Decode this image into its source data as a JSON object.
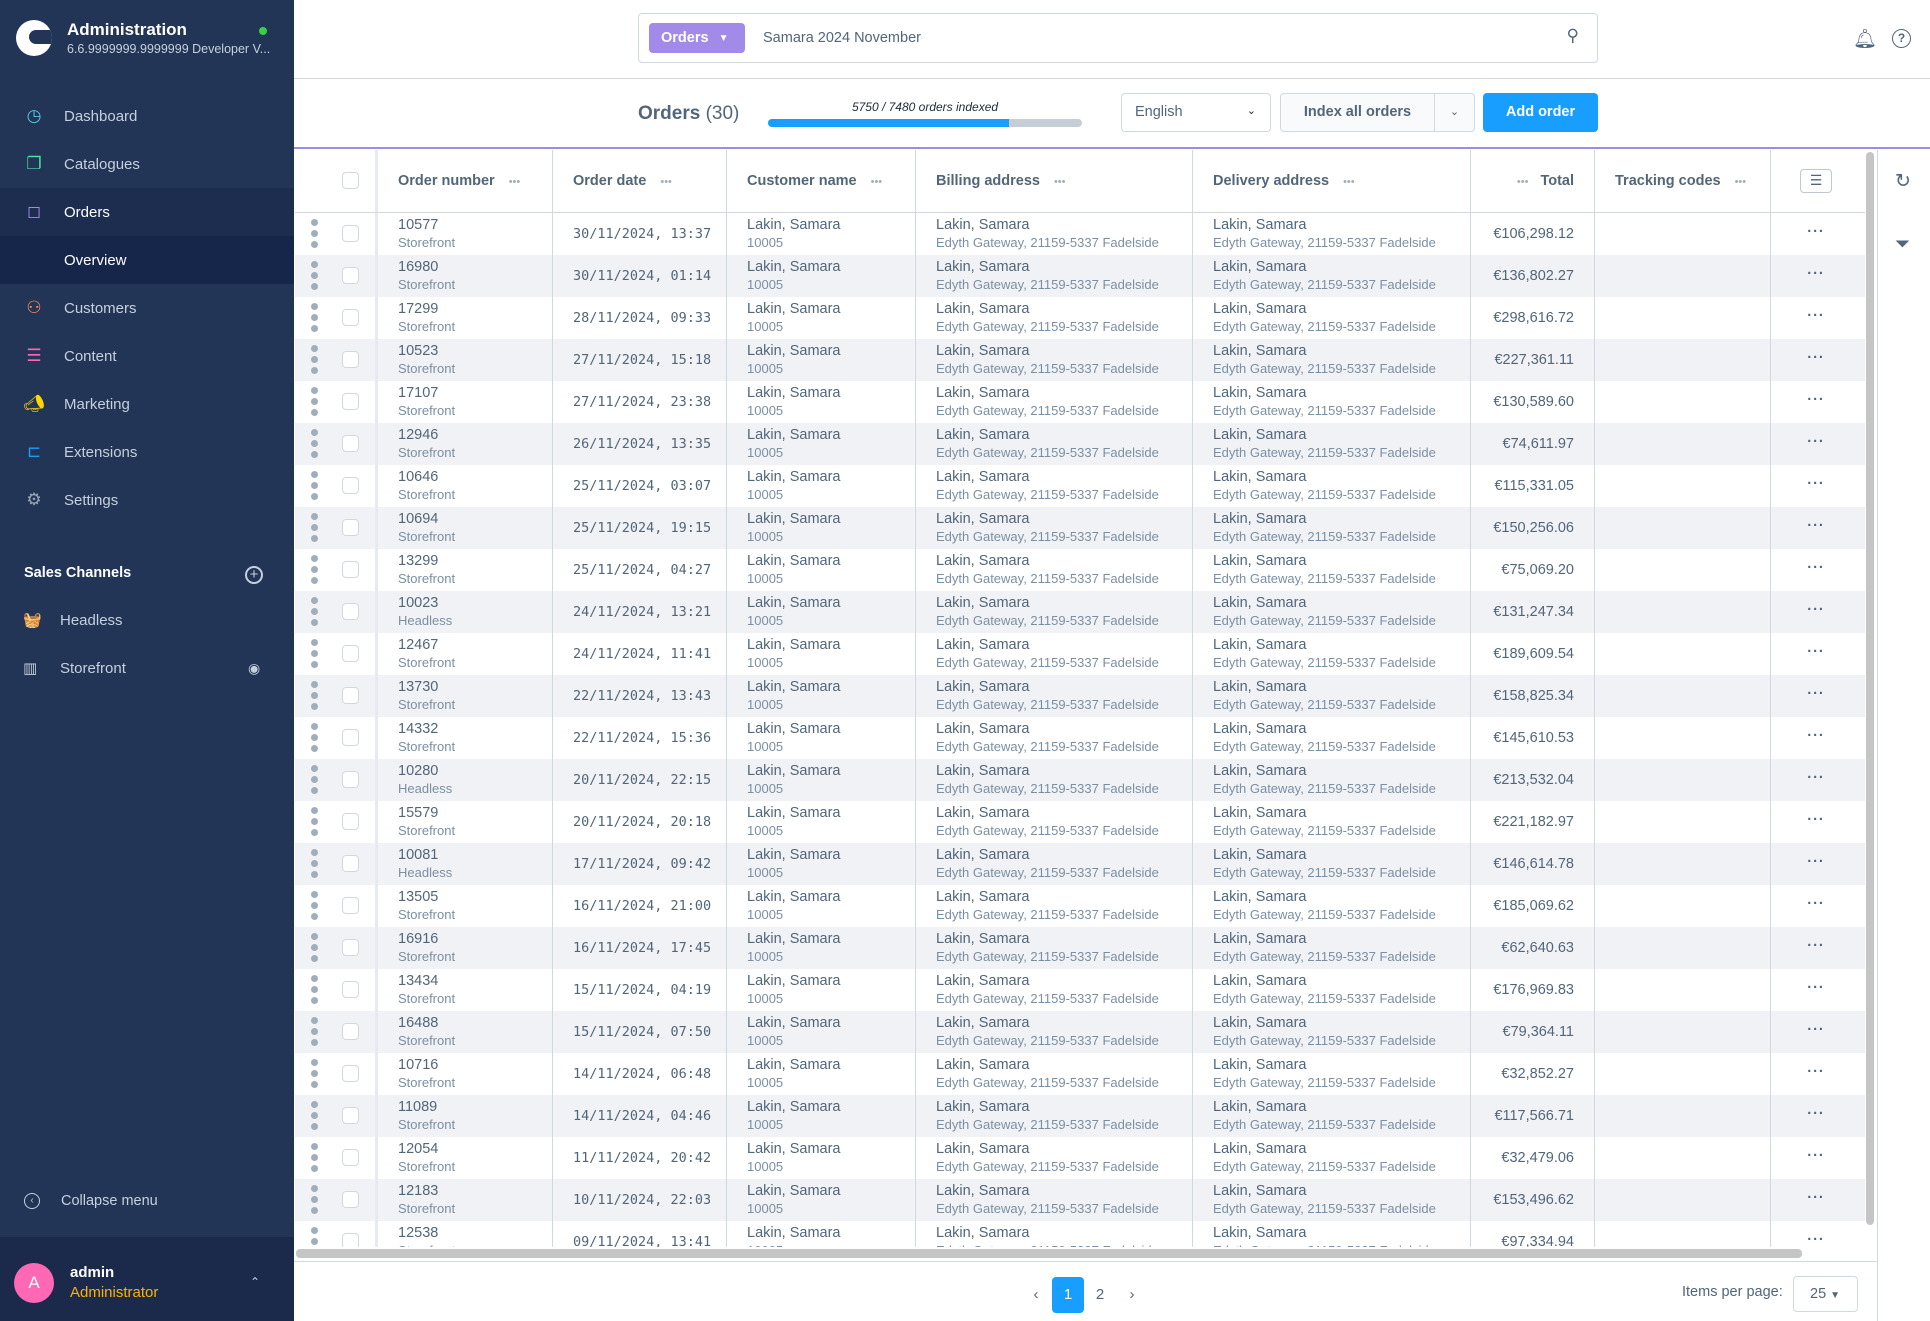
{
  "app": {
    "title": "Administration",
    "version": "6.6.9999999.9999999 Developer V...",
    "status_color": "#37d046"
  },
  "sidebar": {
    "items": [
      {
        "label": "Dashboard",
        "icon": "dashboard-icon",
        "color": "#5bc6e8"
      },
      {
        "label": "Catalogues",
        "icon": "catalogue-icon",
        "color": "#57d9a3"
      },
      {
        "label": "Orders",
        "icon": "orders-icon",
        "color": "#a28ae8",
        "active": true
      },
      {
        "label": "Overview",
        "sub": true
      },
      {
        "label": "Customers",
        "icon": "customers-icon",
        "color": "#ff8f57"
      },
      {
        "label": "Content",
        "icon": "content-icon",
        "color": "#ff68b4"
      },
      {
        "label": "Marketing",
        "icon": "marketing-icon",
        "color": "#ffd700"
      },
      {
        "label": "Extensions",
        "icon": "extensions-icon",
        "color": "#189eff"
      },
      {
        "label": "Settings",
        "icon": "settings-icon",
        "color": "#9aa8b5"
      }
    ],
    "sales_channels_title": "Sales Channels",
    "channels": [
      {
        "label": "Headless"
      },
      {
        "label": "Storefront"
      }
    ],
    "collapse_label": "Collapse menu",
    "user": {
      "initial": "A",
      "name": "admin",
      "role": "Administrator"
    }
  },
  "search": {
    "type": "Orders",
    "value": "Samara 2024 November"
  },
  "page": {
    "title": "Orders",
    "count": "(30)",
    "index_label": "5750 / 7480 orders indexed",
    "index_progress": 0.7687,
    "language": "English",
    "index_button": "Index all orders",
    "add_button": "Add order"
  },
  "table": {
    "columns": [
      "Order number",
      "Order date",
      "Customer name",
      "Billing address",
      "Delivery address",
      "Total",
      "Tracking codes"
    ],
    "rows": [
      [
        "10577",
        "Storefront",
        "30/11/2024, 13:37",
        "€106,298.12"
      ],
      [
        "16980",
        "Storefront",
        "30/11/2024, 01:14",
        "€136,802.27"
      ],
      [
        "17299",
        "Storefront",
        "28/11/2024, 09:33",
        "€298,616.72"
      ],
      [
        "10523",
        "Storefront",
        "27/11/2024, 15:18",
        "€227,361.11"
      ],
      [
        "17107",
        "Storefront",
        "27/11/2024, 23:38",
        "€130,589.60"
      ],
      [
        "12946",
        "Storefront",
        "26/11/2024, 13:35",
        "€74,611.97"
      ],
      [
        "10646",
        "Storefront",
        "25/11/2024, 03:07",
        "€115,331.05"
      ],
      [
        "10694",
        "Storefront",
        "25/11/2024, 19:15",
        "€150,256.06"
      ],
      [
        "13299",
        "Storefront",
        "25/11/2024, 04:27",
        "€75,069.20"
      ],
      [
        "10023",
        "Headless",
        "24/11/2024, 13:21",
        "€131,247.34"
      ],
      [
        "12467",
        "Storefront",
        "24/11/2024, 11:41",
        "€189,609.54"
      ],
      [
        "13730",
        "Storefront",
        "22/11/2024, 13:43",
        "€158,825.34"
      ],
      [
        "14332",
        "Storefront",
        "22/11/2024, 15:36",
        "€145,610.53"
      ],
      [
        "10280",
        "Headless",
        "20/11/2024, 22:15",
        "€213,532.04"
      ],
      [
        "15579",
        "Storefront",
        "20/11/2024, 20:18",
        "€221,182.97"
      ],
      [
        "10081",
        "Headless",
        "17/11/2024, 09:42",
        "€146,614.78"
      ],
      [
        "13505",
        "Storefront",
        "16/11/2024, 21:00",
        "€185,069.62"
      ],
      [
        "16916",
        "Storefront",
        "16/11/2024, 17:45",
        "€62,640.63"
      ],
      [
        "13434",
        "Storefront",
        "15/11/2024, 04:19",
        "€176,969.83"
      ],
      [
        "16488",
        "Storefront",
        "15/11/2024, 07:50",
        "€79,364.11"
      ],
      [
        "10716",
        "Storefront",
        "14/11/2024, 06:48",
        "€32,852.27"
      ],
      [
        "11089",
        "Storefront",
        "14/11/2024, 04:46",
        "€117,566.71"
      ],
      [
        "12054",
        "Storefront",
        "11/11/2024, 20:42",
        "€32,479.06"
      ],
      [
        "12183",
        "Storefront",
        "10/11/2024, 22:03",
        "€153,496.62"
      ],
      [
        "12538",
        "Storefront",
        "09/11/2024, 13:41",
        "€97,334.94"
      ]
    ],
    "customer": {
      "name": "Lakin, Samara",
      "number": "10005"
    },
    "address": {
      "name": "Lakin, Samara",
      "street": "Edyth Gateway, 21159-5337 Fadelside"
    }
  },
  "pagination": {
    "pages": [
      "1",
      "2"
    ],
    "current": "1",
    "prev": "‹",
    "next": "›",
    "items_per_page_label": "Items per page:",
    "items_per_page": "25"
  }
}
